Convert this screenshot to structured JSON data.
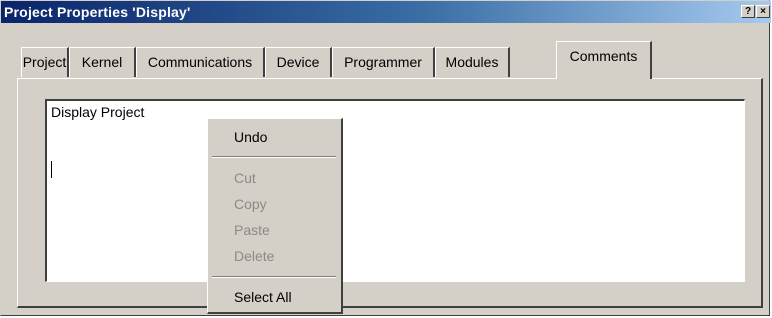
{
  "window": {
    "title": "Project Properties 'Display'",
    "help_glyph": "?",
    "close_glyph": "×"
  },
  "tabs": [
    {
      "label": "Project",
      "active": false
    },
    {
      "label": "Kernel",
      "active": false
    },
    {
      "label": "Communications",
      "active": false
    },
    {
      "label": "Device",
      "active": false
    },
    {
      "label": "Programmer",
      "active": false
    },
    {
      "label": "Modules",
      "active": false
    },
    {
      "label": "Comments",
      "active": true
    }
  ],
  "comments": {
    "text": "Display Project"
  },
  "context_menu": {
    "items": [
      {
        "label": "Undo",
        "enabled": true
      },
      {
        "label": "Cut",
        "enabled": false
      },
      {
        "label": "Copy",
        "enabled": false
      },
      {
        "label": "Paste",
        "enabled": false
      },
      {
        "label": "Delete",
        "enabled": false
      },
      {
        "label": "Select All",
        "enabled": true
      }
    ]
  },
  "colors": {
    "face": "#d4d0c8",
    "title_start": "#0a246a",
    "title_end": "#a6caf0",
    "disabled_text": "#8c8a85"
  }
}
